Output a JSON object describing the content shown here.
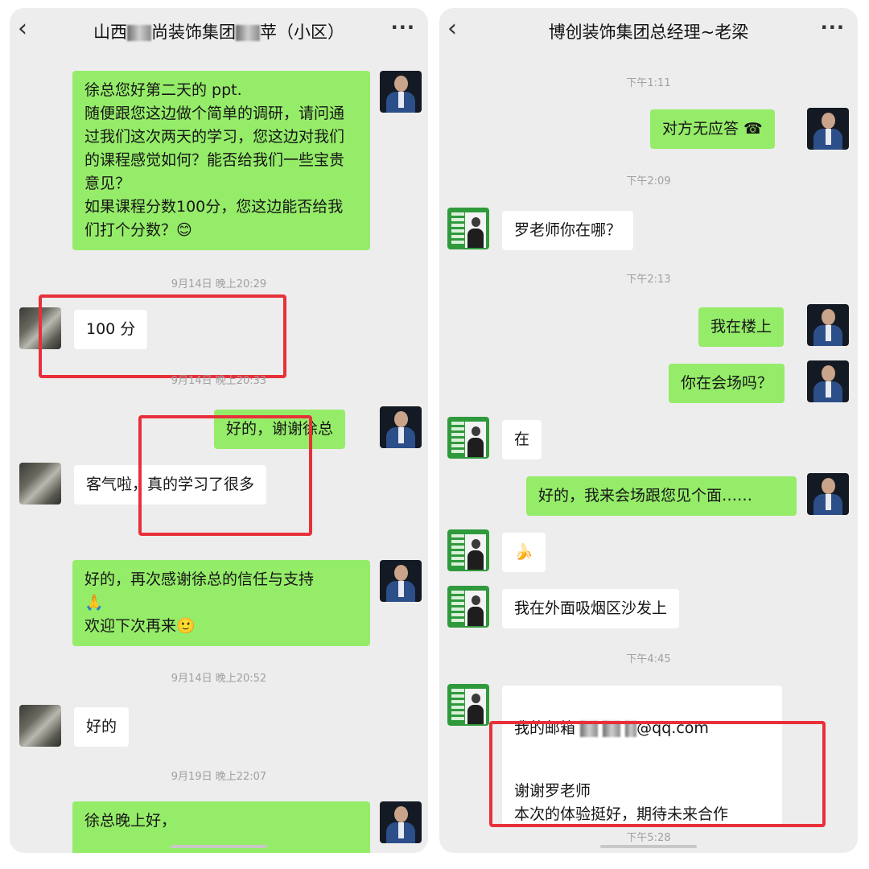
{
  "left": {
    "title_part1": "山西",
    "title_part2": "尚装饰集团",
    "title_part3": "苹（小区）",
    "back_glyph": "‹",
    "more_glyph": "···",
    "messages": [
      {
        "text": "徐总您好第二天的 ppt.\n随便跟您这边做个简单的调研，请问通过我们这次两天的学习，您这边对我们的课程感觉如何？能否给我们一些宝贵意见？\n如果课程分数100分，您这边能否给我们打个分数？😊"
      },
      {
        "text": "100 分"
      },
      {
        "text": "好的，谢谢徐总"
      },
      {
        "text": "客气啦，真的学习了很多"
      },
      {
        "text": "好的，再次感谢徐总的信任与支持\n🙏\n欢迎下次再来🙂"
      },
      {
        "text": "好的"
      },
      {
        "text": "徐总晚上好，"
      }
    ],
    "timestamps": [
      "9月14日 晚上20:29",
      "9月14日 晚上20:33",
      "9月14日 晚上20:52",
      "9月19日 晚上22:07"
    ]
  },
  "right": {
    "title": "博创装饰集团总经理~老梁",
    "back_glyph": "‹",
    "more_glyph": "···",
    "messages": [
      {
        "text": "对方无应答 ☎"
      },
      {
        "text": "罗老师你在哪？"
      },
      {
        "text": "我在楼上"
      },
      {
        "text": "你在会场吗？"
      },
      {
        "text": "在"
      },
      {
        "text": "好的，我来会场跟您见个面……"
      },
      {
        "text": "🍌"
      },
      {
        "text": "我在外面吸烟区沙发上"
      },
      {
        "text_prefix": "我的邮箱",
        "text_suffix": "@qq.com"
      },
      {
        "text": "谢谢罗老师\n本次的体验挺好，期待未来合作"
      }
    ],
    "timestamps": [
      "下午1:11",
      "下午2:09",
      "下午2:13",
      "下午4:45",
      "下午5:28"
    ]
  },
  "colors": {
    "sent_bubble": "#95ec69",
    "received_bubble": "#ffffff",
    "chat_bg": "#ededed",
    "highlight_box": "#e8303a"
  }
}
